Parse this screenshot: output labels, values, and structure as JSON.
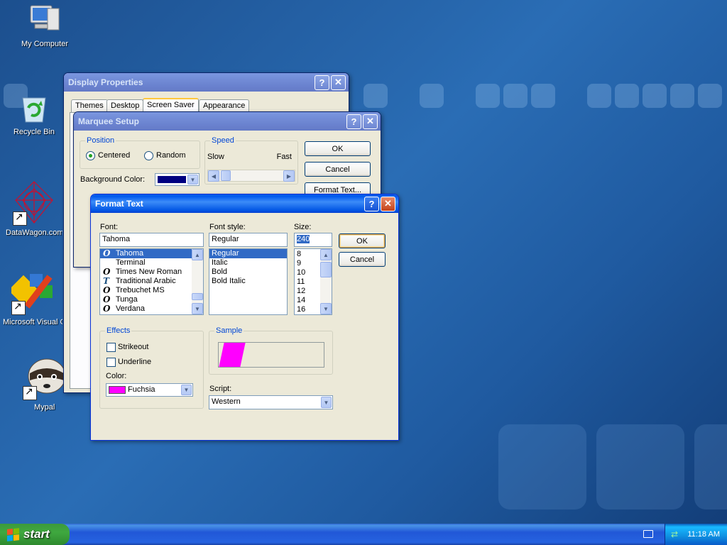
{
  "desktop": {
    "icons": [
      {
        "label": "My Computer",
        "icon": "my-computer-icon"
      },
      {
        "label": "Recycle Bin",
        "icon": "recycle-bin-icon"
      },
      {
        "label": "DataWagon.com",
        "icon": "datawagon-icon"
      },
      {
        "label": "Microsoft Visual C++",
        "icon": "visual-cpp-icon"
      },
      {
        "label": "Mypal",
        "icon": "mypal-icon"
      }
    ]
  },
  "display_properties": {
    "title": "Display Properties",
    "tabs": [
      "Themes",
      "Desktop",
      "Screen Saver",
      "Appearance"
    ],
    "selected_tab": "Screen Saver"
  },
  "marquee_setup": {
    "title": "Marquee Setup",
    "position_group": "Position",
    "centered_label": "Centered",
    "random_label": "Random",
    "position_selected": "Centered",
    "speed_group": "Speed",
    "slow_label": "Slow",
    "fast_label": "Fast",
    "background_color_label": "Background Color:",
    "background_color": "#000080",
    "ok": "OK",
    "cancel": "Cancel",
    "format_text": "Format Text..."
  },
  "format_text": {
    "title": "Format Text",
    "font_label": "Font:",
    "font_value": "Tahoma",
    "fonts": [
      {
        "name": "Tahoma",
        "selected": true,
        "glyph": "O"
      },
      {
        "name": "Terminal",
        "selected": false,
        "glyph": ""
      },
      {
        "name": "Times New Roman",
        "selected": false,
        "glyph": "O"
      },
      {
        "name": "Traditional Arabic",
        "selected": false,
        "glyph": "T"
      },
      {
        "name": "Trebuchet MS",
        "selected": false,
        "glyph": "O"
      },
      {
        "name": "Tunga",
        "selected": false,
        "glyph": "O"
      },
      {
        "name": "Verdana",
        "selected": false,
        "glyph": "O"
      }
    ],
    "style_label": "Font style:",
    "style_value": "Regular",
    "styles": [
      {
        "name": "Regular",
        "selected": true
      },
      {
        "name": "Italic",
        "selected": false
      },
      {
        "name": "Bold",
        "selected": false
      },
      {
        "name": "Bold Italic",
        "selected": false
      }
    ],
    "size_label": "Size:",
    "size_value": "240",
    "sizes": [
      "8",
      "9",
      "10",
      "11",
      "12",
      "14",
      "16"
    ],
    "ok": "OK",
    "cancel": "Cancel",
    "effects_group": "Effects",
    "strikeout_label": "Strikeout",
    "underline_label": "Underline",
    "color_label": "Color:",
    "color_value": "Fuchsia",
    "color_hex": "#ff00ff",
    "sample_group": "Sample",
    "script_label": "Script:",
    "script_value": "Western"
  },
  "taskbar": {
    "start_label": "start",
    "clock": "11:18 AM"
  }
}
